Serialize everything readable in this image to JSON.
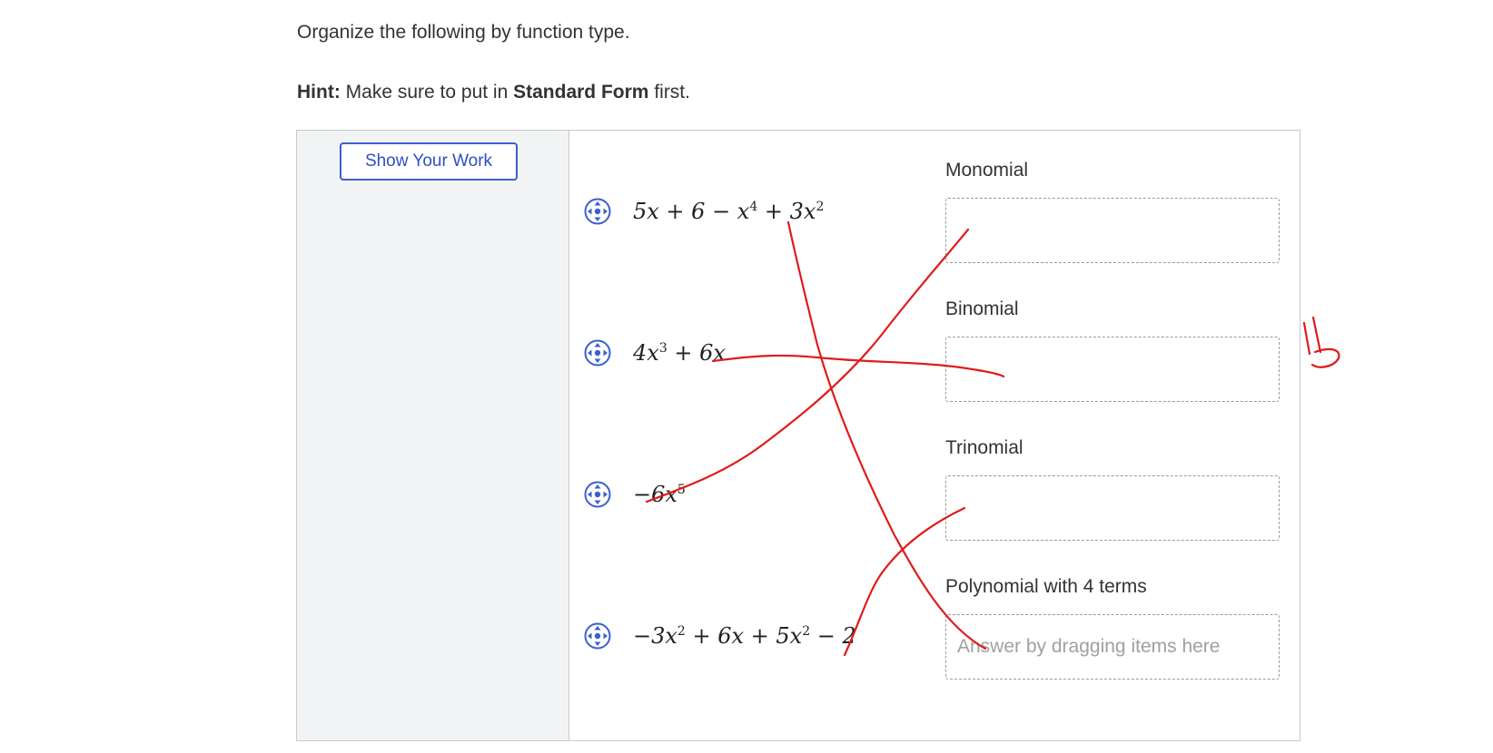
{
  "instructions": {
    "prompt": "Organize the following by function type.",
    "hint_label": "Hint:",
    "hint_text_1": "Make sure to put in",
    "hint_bold": "Standard Form",
    "hint_text_2": "first."
  },
  "toolbar": {
    "show_work_label": "Show Your Work"
  },
  "items": [
    {
      "icon": "drag-move-icon"
    },
    {
      "icon": "drag-move-icon"
    },
    {
      "icon": "drag-move-icon"
    },
    {
      "icon": "drag-move-icon"
    }
  ],
  "categories": [
    {
      "label": "Monomial",
      "placeholder": ""
    },
    {
      "label": "Binomial",
      "placeholder": ""
    },
    {
      "label": "Trinomial",
      "placeholder": ""
    },
    {
      "label": "Polynomial with 4 terms",
      "placeholder": "Answer by dragging items here"
    }
  ],
  "colors": {
    "accent": "#3b5fcf",
    "annotation": "#e01b1b"
  }
}
